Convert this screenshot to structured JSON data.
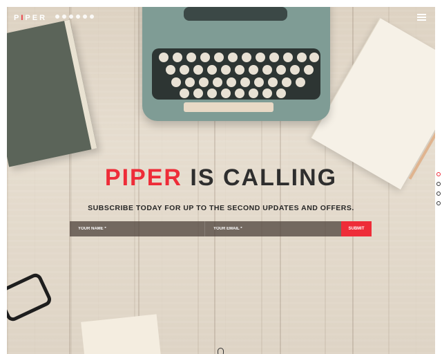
{
  "header": {
    "logo_prefix": "P",
    "logo_accent": "I",
    "logo_suffix": "PER",
    "social_icons": [
      "twitter-icon",
      "facebook-icon",
      "instagram-icon",
      "pinterest-icon",
      "linkedin-icon",
      "youtube-icon"
    ]
  },
  "hero": {
    "title_accent": "PIPER",
    "title_rest": "IS CALLING",
    "subtitle": "SUBSCRIBE TODAY FOR UP TO THE SECOND UPDATES AND OFFERS."
  },
  "form": {
    "name_placeholder": "YOUR NAME *",
    "email_placeholder": "YOUR EMAIL *",
    "submit_label": "SUBMIT"
  },
  "colors": {
    "accent": "#ee2c38",
    "text_dark": "#2e2e2e"
  },
  "section_nav": {
    "count": 4,
    "active_index": 0
  }
}
